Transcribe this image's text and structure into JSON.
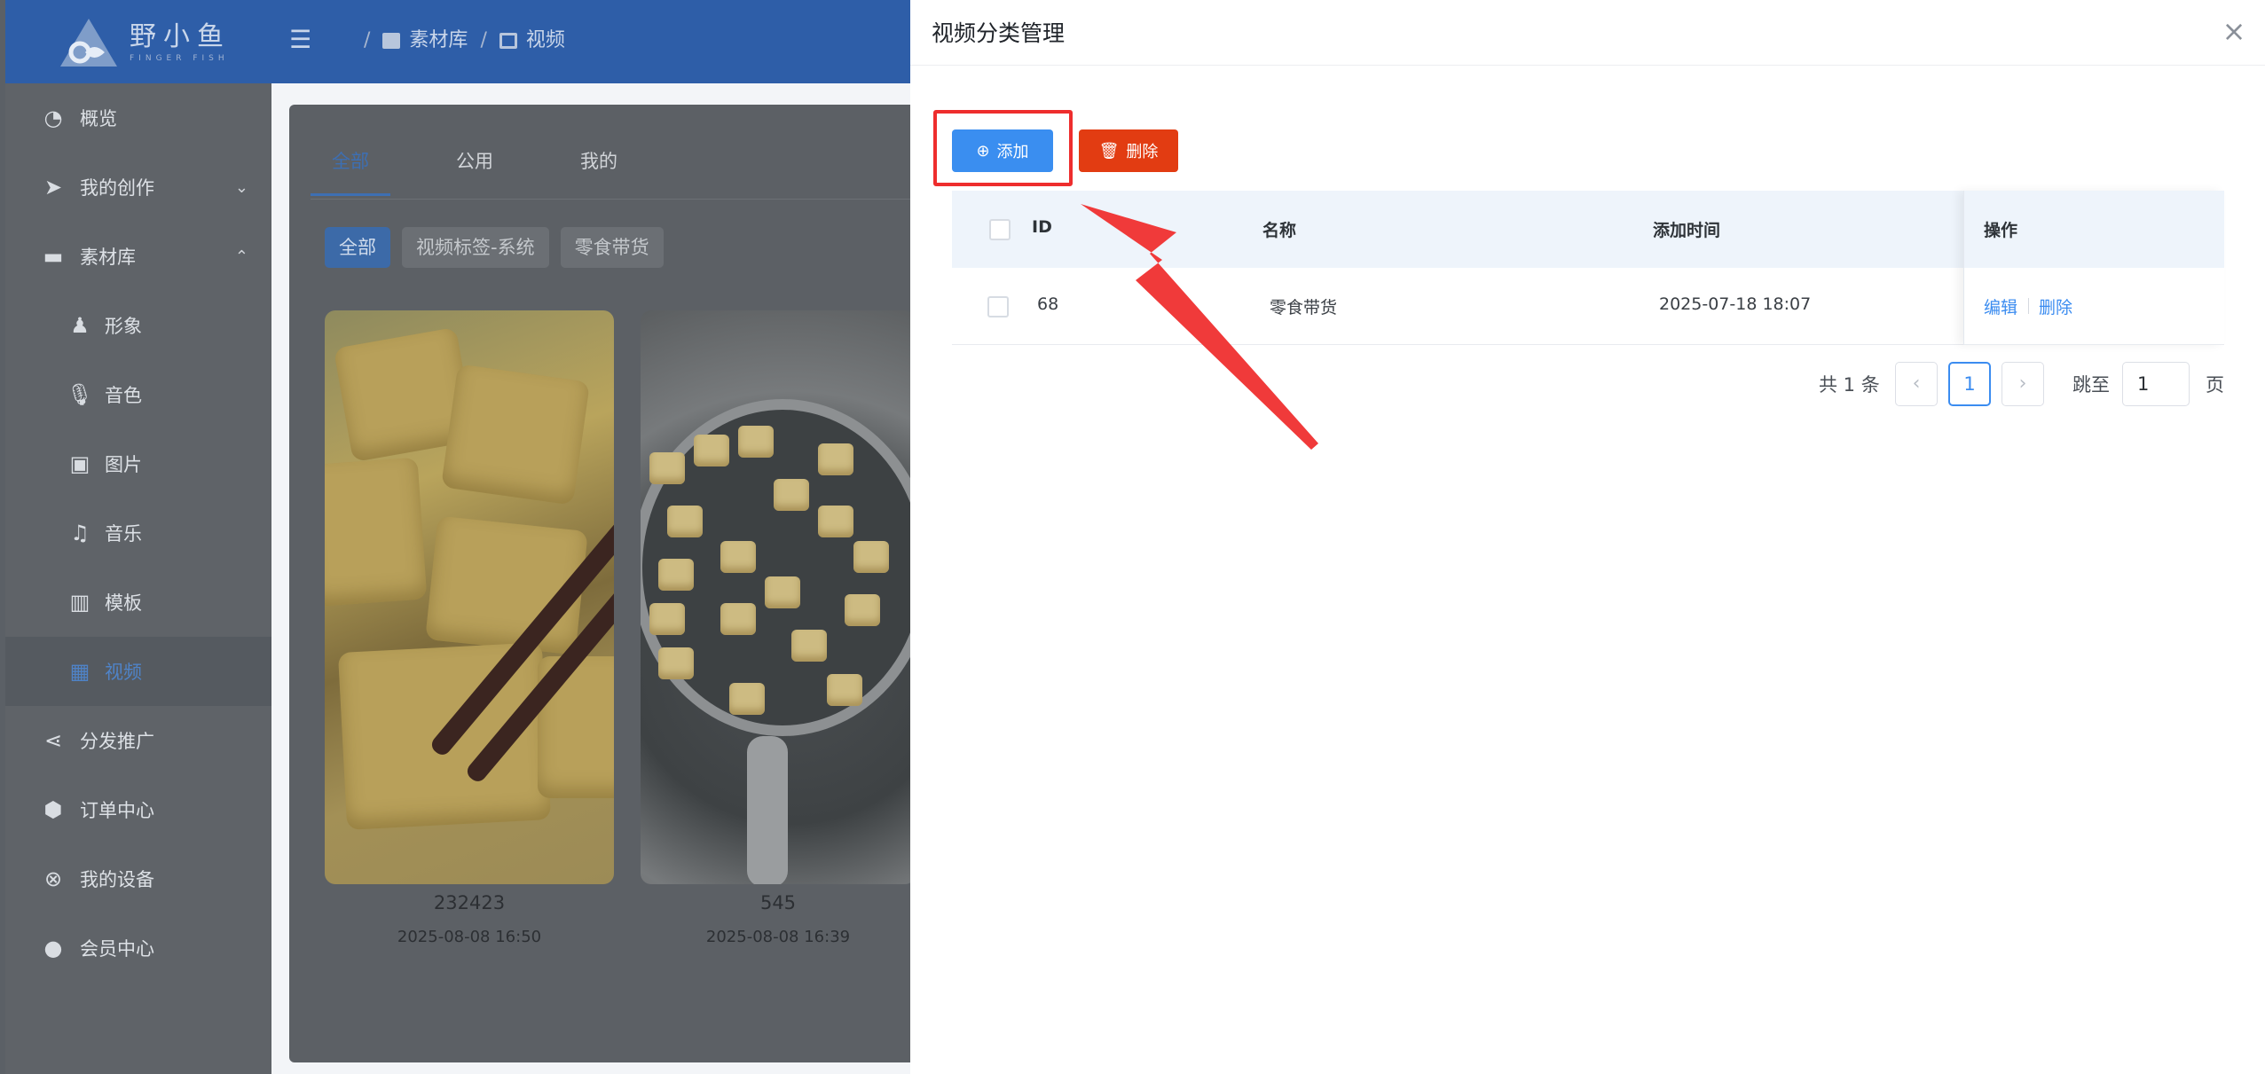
{
  "header": {
    "logo": {
      "name": "野小鱼",
      "subtitle": "FINGER FISH"
    },
    "breadcrumb": [
      "素材库",
      "视频"
    ]
  },
  "sidebar": {
    "items": [
      {
        "label": "概览",
        "icon": "dashboard-icon"
      },
      {
        "label": "我的创作",
        "icon": "send-icon",
        "chevron": "⌄"
      },
      {
        "label": "素材库",
        "icon": "folder-icon",
        "chevron": "⌃"
      },
      {
        "label": "形象",
        "icon": "person-icon"
      },
      {
        "label": "音色",
        "icon": "microphone-icon"
      },
      {
        "label": "图片",
        "icon": "image-icon"
      },
      {
        "label": "音乐",
        "icon": "music-icon"
      },
      {
        "label": "模板",
        "icon": "template-icon"
      },
      {
        "label": "视频",
        "icon": "video-icon",
        "active": true
      },
      {
        "label": "分发推广",
        "icon": "share-icon"
      },
      {
        "label": "订单中心",
        "icon": "box-icon"
      },
      {
        "label": "我的设备",
        "icon": "device-icon"
      },
      {
        "label": "会员中心",
        "icon": "user-icon"
      }
    ]
  },
  "main": {
    "tabs": [
      "全部",
      "公用",
      "我的"
    ],
    "chips": [
      "全部",
      "视频标签-系统",
      "零食带货"
    ],
    "cards": [
      {
        "title": "232423",
        "date": "2025-08-08 16:50"
      },
      {
        "title": "545",
        "date": "2025-08-08 16:39"
      }
    ]
  },
  "drawer": {
    "title": "视频分类管理",
    "close": "×",
    "buttons": {
      "add": "添加",
      "delete": "删除"
    },
    "table": {
      "columns": [
        "ID",
        "名称",
        "添加时间",
        "操作"
      ],
      "rows": [
        {
          "id": "68",
          "name": "零食带货",
          "time": "2025-07-18 18:07",
          "actions": [
            "编辑",
            "删除"
          ]
        }
      ]
    },
    "pagination": {
      "total": "共 1 条",
      "prev": "‹",
      "current": "1",
      "next": "›",
      "jump_label": "跳至",
      "jump_value": "1",
      "page_label": "页"
    }
  },
  "colors": {
    "primary": "#3a8ef0",
    "danger": "#e23c12",
    "annotation": "#ee2d2d",
    "header": "#2e5ea8"
  }
}
